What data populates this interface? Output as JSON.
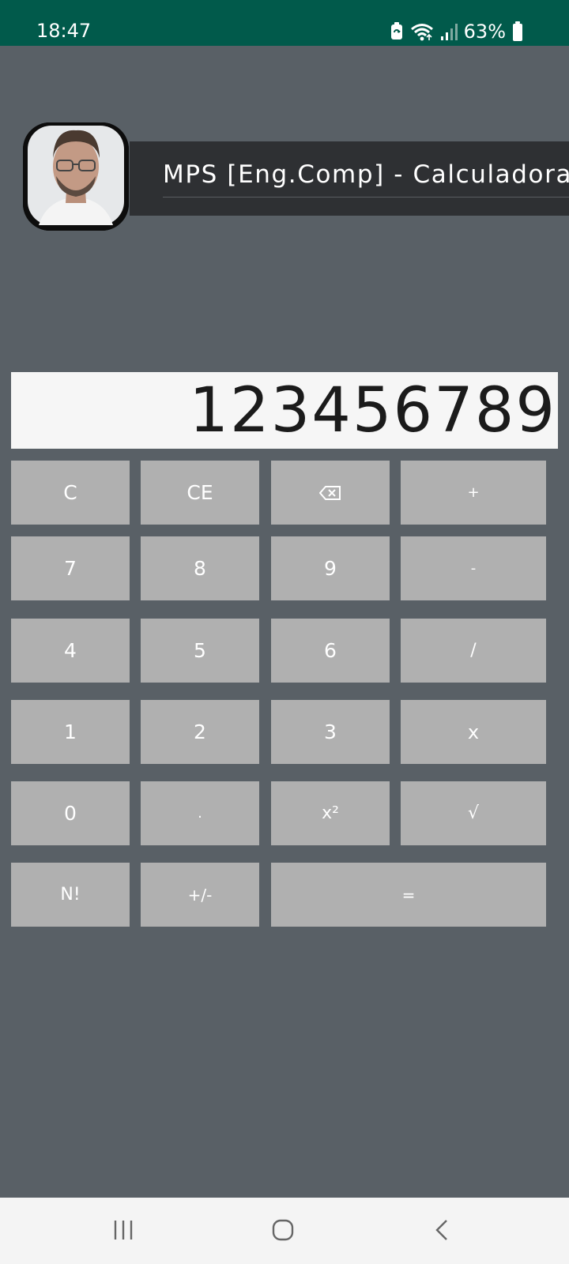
{
  "status_bar": {
    "time": "18:47",
    "battery_percent": "63%",
    "icons": [
      "battery-saver-icon",
      "wifi-icon",
      "signal-icon",
      "battery-icon"
    ]
  },
  "header": {
    "title": "MPS [Eng.Comp] - Calculadora"
  },
  "display": {
    "value": "123456789"
  },
  "keypad": {
    "c": "C",
    "ce": "CE",
    "backspace": "⌫",
    "plus": "+",
    "seven": "7",
    "eight": "8",
    "nine": "9",
    "minus": "-",
    "four": "4",
    "five": "5",
    "six": "6",
    "divide": "/",
    "one": "1",
    "two": "2",
    "three": "3",
    "multiply": "x",
    "zero": "0",
    "dot": ".",
    "square": "x²",
    "sqrt": "√",
    "factorial": "N!",
    "sign": "+/-",
    "equals": "="
  },
  "colors": {
    "status_bar": "#015a4b",
    "background": "#596066",
    "title_banner": "#2e3033",
    "display": "#f6f6f6",
    "key": "#b0b0b0",
    "nav_bar": "#f4f4f4"
  }
}
